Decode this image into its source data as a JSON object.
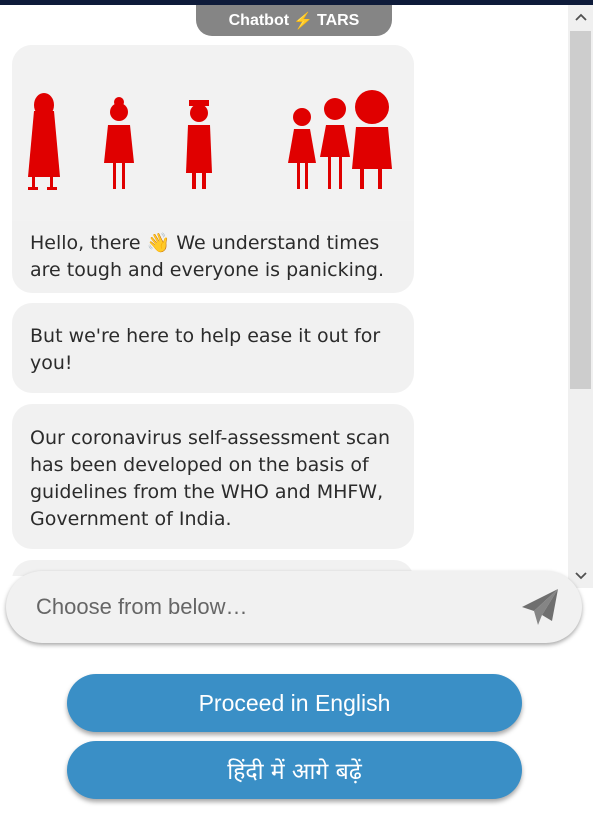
{
  "header": {
    "badge_left": "Chatbot",
    "badge_right": "TARS",
    "bolt_icon": "lightning-bolt-icon"
  },
  "messages": [
    {
      "text_before": "Hello, there",
      "emoji": "👋",
      "text_after": "We understand times are tough and everyone is panicking."
    },
    {
      "text": "But we're here to help ease it out for you!"
    },
    {
      "text": "Our coronavirus self-assessment scan has been developed on the basis of guidelines from the WHO and MHFW, Government of India."
    }
  ],
  "composer": {
    "placeholder": "Choose from below…",
    "send_icon": "paper-plane-icon"
  },
  "options": {
    "english": "Proceed in English",
    "hindi": "हिंदी में आगे बढ़ें"
  },
  "colors": {
    "accent": "#3a8fc6",
    "illustration": "#e00000",
    "bubble": "#f1f1f1",
    "badge": "#858585",
    "topbar": "#0e1b3a"
  }
}
